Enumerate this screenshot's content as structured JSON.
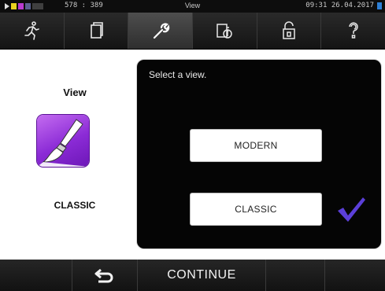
{
  "status_bar": {
    "counter": "578 : 389",
    "title": "View",
    "time": "09:31",
    "date": "26.04.2017",
    "icons": [
      "play-icon",
      "card-icon",
      "battery-icon",
      "flask-icon",
      "signal-icon"
    ]
  },
  "toolbar": {
    "tabs": [
      {
        "icon": "runner-icon",
        "active": false
      },
      {
        "icon": "document-icon",
        "active": false
      },
      {
        "icon": "wrench-icon",
        "active": true
      },
      {
        "icon": "info-document-icon",
        "active": false
      },
      {
        "icon": "padlock-icon",
        "active": false
      },
      {
        "icon": "question-mark-icon",
        "active": false
      }
    ]
  },
  "left_pane": {
    "title": "View",
    "tile_icon": "paintbrush-icon",
    "current_view": "CLASSIC"
  },
  "panel": {
    "prompt": "Select a view.",
    "options": [
      "MODERN",
      "CLASSIC"
    ],
    "selected": "CLASSIC"
  },
  "bottom_bar": {
    "back_icon": "return-arrow-icon",
    "continue_label": "CONTINUE"
  },
  "colors": {
    "accent_purple": "#8b2bd6",
    "checkmark": "#5b3fd8",
    "panel_bg": "#050505",
    "bar_bg": "#1a1a1a"
  }
}
